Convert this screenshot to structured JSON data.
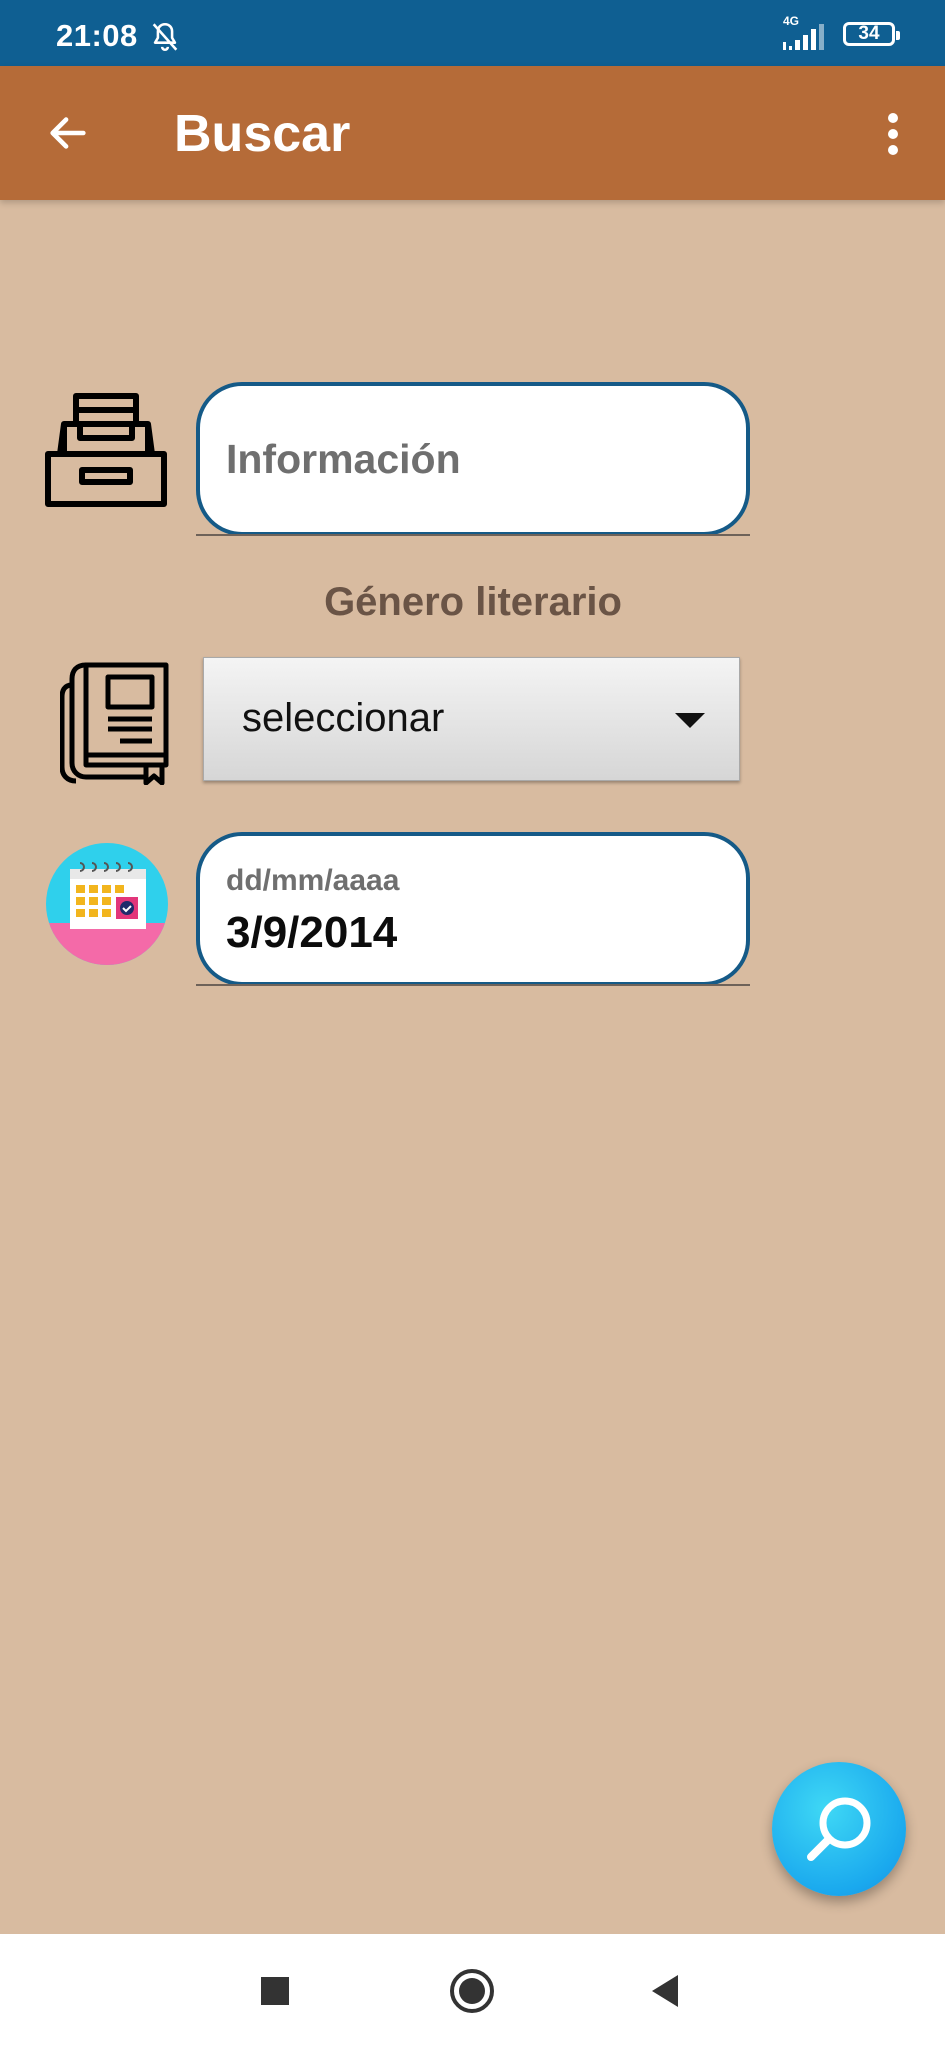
{
  "status_bar": {
    "time": "21:08",
    "network": "4G",
    "battery": "34"
  },
  "app_bar": {
    "title": "Buscar",
    "back_icon": "arrow-left-icon",
    "menu_icon": "more-vert-icon",
    "color": "#b56b38"
  },
  "form": {
    "info_placeholder": "Información",
    "info_icon": "inbox-tray-icon",
    "genre_label": "Género literario",
    "genre_icon": "books-icon",
    "genre_selected": "seleccionar",
    "date_hint": "dd/mm/aaaa",
    "date_value": "3/9/2014",
    "date_icon": "calendar-icon"
  },
  "fab": {
    "icon": "search-icon",
    "color": "#1aa9ee"
  },
  "nav_bar": {
    "recent_icon": "square-icon",
    "home_icon": "circle-icon",
    "back_icon": "triangle-back-icon"
  },
  "colors": {
    "background": "#d8bba0",
    "status_bar": "#0f5f92",
    "field_border": "#155a87"
  }
}
